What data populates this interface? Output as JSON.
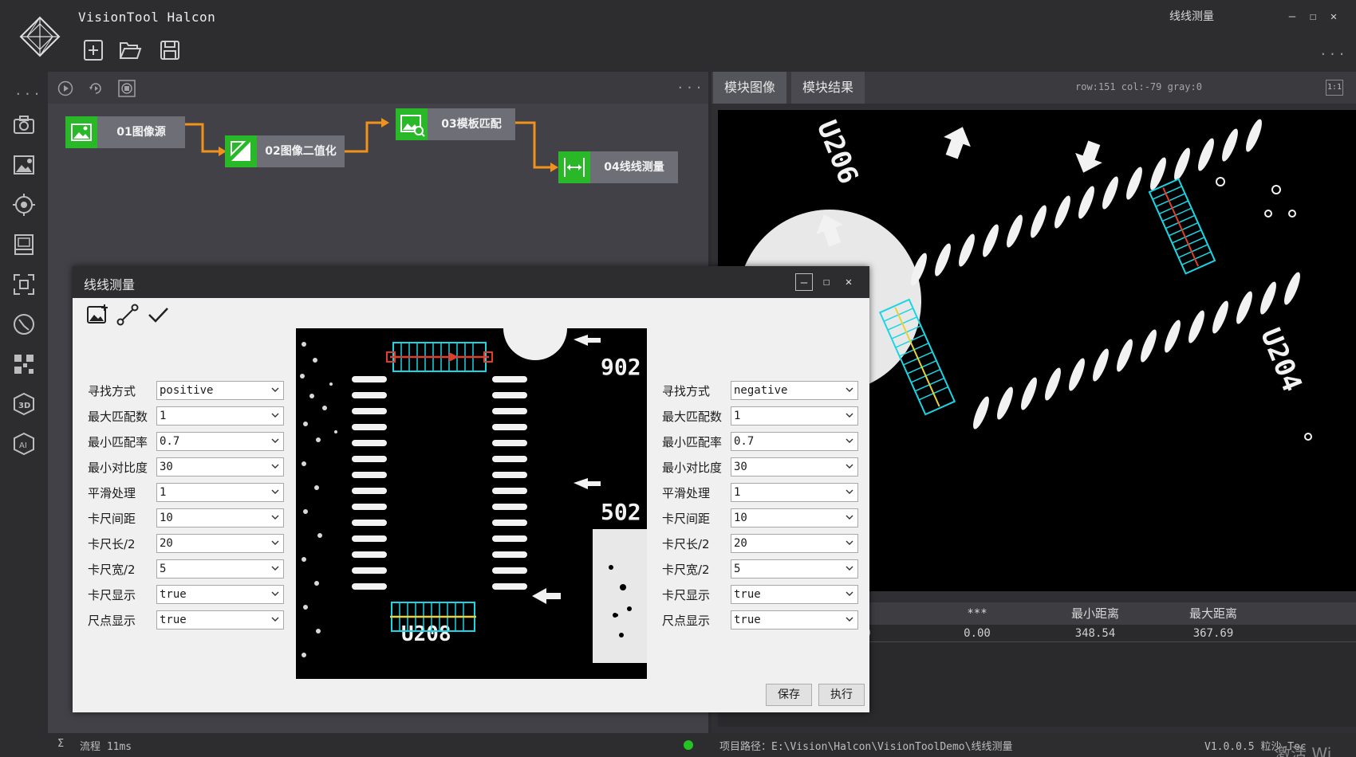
{
  "app": {
    "title": "VisionTool Halcon",
    "window_title": "线线测量",
    "more": "...",
    "win_min": "—",
    "win_max": "☐",
    "win_close": "✕"
  },
  "toolbar": [
    "new-file-icon",
    "open-folder-icon",
    "save-icon"
  ],
  "sidebar": [
    "camera-icon",
    "image-settings-icon",
    "target-icon",
    "gallery-icon",
    "focus-frame-icon",
    "clock-icon",
    "qr-code-icon",
    "cube-3d-icon",
    "ai-icon"
  ],
  "flow": {
    "more": "...",
    "nodes": [
      {
        "label": "01图像源"
      },
      {
        "label": "02图像二值化"
      },
      {
        "label": "03模板匹配"
      },
      {
        "label": "04线线测量"
      }
    ],
    "arrow_color": "#f0921c",
    "node_green": "#28b828"
  },
  "right_panel": {
    "tabs": [
      "模块图像",
      "模块结果"
    ],
    "coord_readout": "row:151 col:-79 gray:0",
    "fit_button": "1:1",
    "result_table": {
      "headers": [
        "***",
        "***",
        "最小距离",
        "最大距离"
      ],
      "row": [
        "0.00",
        "0.00",
        "348.54",
        "367.69"
      ]
    }
  },
  "status": {
    "flow_label": "流程 11ms",
    "project_path": "项目路径：E:\\Vision\\Halcon\\VisionToolDemo\\线线测量",
    "version": "V1.0.0.5 粒沙-Tec",
    "watermark": "激活 Wi",
    "indicator_color": "#22c322"
  },
  "dialog": {
    "title": "线线测量",
    "min": "—",
    "max": "☐",
    "close": "✕",
    "params_left": [
      {
        "label": "寻找方式",
        "value": "positive"
      },
      {
        "label": "最大匹配数",
        "value": "1"
      },
      {
        "label": "最小匹配率",
        "value": "0.7"
      },
      {
        "label": "最小对比度",
        "value": "30"
      },
      {
        "label": "平滑处理",
        "value": "1"
      },
      {
        "label": "卡尺间距",
        "value": "10"
      },
      {
        "label": "卡尺长/2",
        "value": "20"
      },
      {
        "label": "卡尺宽/2",
        "value": "5"
      },
      {
        "label": "卡尺显示",
        "value": "true"
      },
      {
        "label": "尺点显示",
        "value": "true"
      }
    ],
    "params_right": [
      {
        "label": "寻找方式",
        "value": "negative"
      },
      {
        "label": "最大匹配数",
        "value": "1"
      },
      {
        "label": "最小匹配率",
        "value": "0.7"
      },
      {
        "label": "最小对比度",
        "value": "30"
      },
      {
        "label": "平滑处理",
        "value": "1"
      },
      {
        "label": "卡尺间距",
        "value": "10"
      },
      {
        "label": "卡尺长/2",
        "value": "20"
      },
      {
        "label": "卡尺宽/2",
        "value": "5"
      },
      {
        "label": "卡尺显示",
        "value": "true"
      },
      {
        "label": "尺点显示",
        "value": "true"
      }
    ],
    "save_label": "保存",
    "run_label": "执行"
  },
  "image_text": {
    "chip_label_a": "U206",
    "chip_label_b": "U204",
    "pcb_label_a": "902",
    "pcb_label_b": "502",
    "pcb_label_c": "U208"
  }
}
